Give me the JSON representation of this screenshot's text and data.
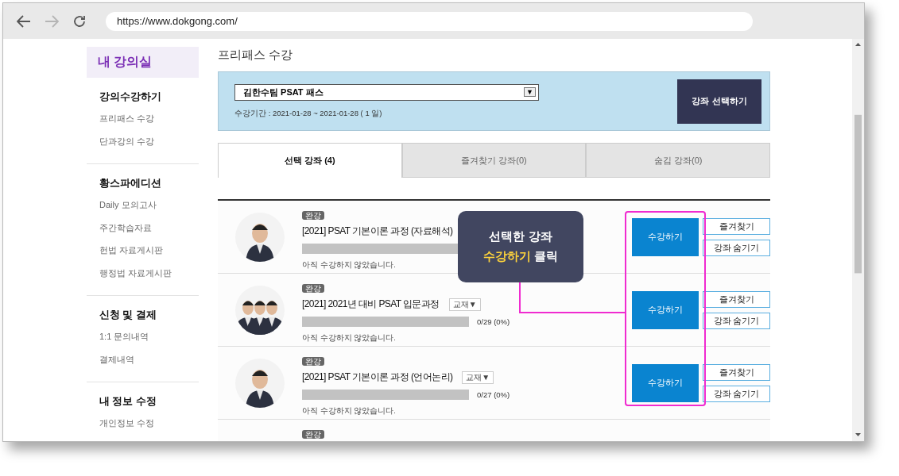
{
  "browser": {
    "url": "https://www.dokgong.com/",
    "back_disabled": false,
    "forward_disabled": true
  },
  "sidebar": {
    "title": "내 강의실",
    "groups": [
      {
        "heading": "강의수강하기",
        "items": [
          "프리패스 수강",
          "단과강의 수강"
        ]
      },
      {
        "heading": "황스파에디션",
        "items": [
          "Daily 모의고사",
          "주간학습자료",
          "헌법 자료게시판",
          "행정법 자료게시판"
        ]
      },
      {
        "heading": "신청 및 결제",
        "items": [
          "1:1 문의내역",
          "결제내역"
        ]
      },
      {
        "heading": "내 정보 수정",
        "items": [
          "개인정보 수정"
        ]
      }
    ]
  },
  "page_title": "프리패스 수강",
  "pass": {
    "select_value": "김한수팀 PSAT 패스",
    "select_arrow": "▼",
    "period": "수강기간 : 2021-01-28 ~ 2021-01-28 ( 1 일)",
    "button": "강좌 선택하기"
  },
  "tabs": [
    {
      "label": "선택 강좌 (4)",
      "selected": true
    },
    {
      "label": "즐겨찾기 강좌(0)",
      "selected": false
    },
    {
      "label": "숨김 강좌(0)",
      "selected": false
    }
  ],
  "courses": [
    {
      "badge": "완강",
      "title": "[2021] PSAT 기본이론 과정 (자료해석)",
      "note": "아직 수강하지 않았습니다.",
      "kind": "single",
      "actions": [
        "수강하기",
        "즐겨찾기",
        "강좌 숨기기"
      ]
    },
    {
      "badge": "완강",
      "title": "[2021] 2021년 대비 PSAT 입문과정",
      "tag": "교재▼",
      "reading": "0/29 (0%)",
      "note": "아직 수강하지 않았습니다.",
      "kind": "group",
      "actions": [
        "수강하기",
        "즐겨찾기",
        "강좌 숨기기"
      ]
    },
    {
      "badge": "완강",
      "title": "[2021] PSAT 기본이론 과정 (언어논리)",
      "tag": "교재▼",
      "reading": "0/27 (0%)",
      "note": "아직 수강하지 않았습니다.",
      "kind": "single",
      "actions": [
        "수강하기",
        "즐겨찾기",
        "강좌 숨기기"
      ]
    },
    {
      "badge": "완강",
      "kind": "partial"
    }
  ],
  "callout": {
    "line1": "선택한 강좌",
    "highlight": "수강하기",
    "rest": "클릭"
  }
}
